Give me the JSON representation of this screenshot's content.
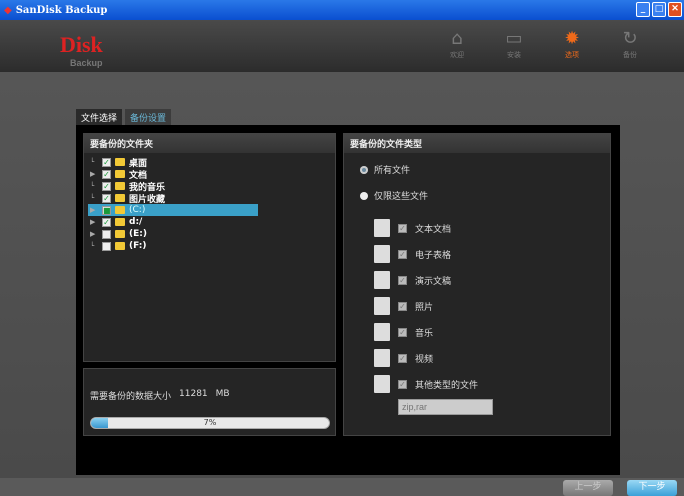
{
  "window": {
    "title": "SanDisk Backup"
  },
  "header": {
    "logo": "Disk",
    "logo_sub": "Backup",
    "nav": [
      {
        "label": "欢迎",
        "icon": "home-icon"
      },
      {
        "label": "安装",
        "icon": "monitor-icon"
      },
      {
        "label": "选项",
        "icon": "gear-icon"
      },
      {
        "label": "备份",
        "icon": "backup-icon"
      }
    ],
    "accent": "#f06a1a"
  },
  "tabs": [
    {
      "label": "文件选择"
    },
    {
      "label": "备份设置"
    }
  ],
  "folders": {
    "title": "要备份的文件夹",
    "items": [
      {
        "label": "桌面",
        "checked": true,
        "expandable": false
      },
      {
        "label": "文档",
        "checked": true,
        "expandable": true
      },
      {
        "label": "我的音乐",
        "checked": true,
        "expandable": false
      },
      {
        "label": "图片收藏",
        "checked": true,
        "expandable": false
      },
      {
        "label": "(C:)",
        "checked": "partial",
        "expandable": true,
        "selected": true
      },
      {
        "label": "d:/",
        "checked": true,
        "expandable": true
      },
      {
        "label": "(E:)",
        "checked": false,
        "expandable": true
      },
      {
        "label": "(F:)",
        "checked": false,
        "expandable": false
      }
    ]
  },
  "size": {
    "label": "需要备份的数据大小",
    "value": "11281",
    "unit": "MB",
    "progress_percent": 7,
    "progress_label": "7%"
  },
  "types": {
    "title": "要备份的文件类型",
    "radio_all": "所有文件",
    "radio_only": "仅限这些文件",
    "items": [
      {
        "label": "文本文档"
      },
      {
        "label": "电子表格"
      },
      {
        "label": "演示文稿"
      },
      {
        "label": "照片"
      },
      {
        "label": "音乐"
      },
      {
        "label": "视频"
      },
      {
        "label": "其他类型的文件"
      }
    ],
    "ext_placeholder": "zip,rar"
  },
  "buttons": {
    "prev": "上一步",
    "next": "下一步"
  }
}
